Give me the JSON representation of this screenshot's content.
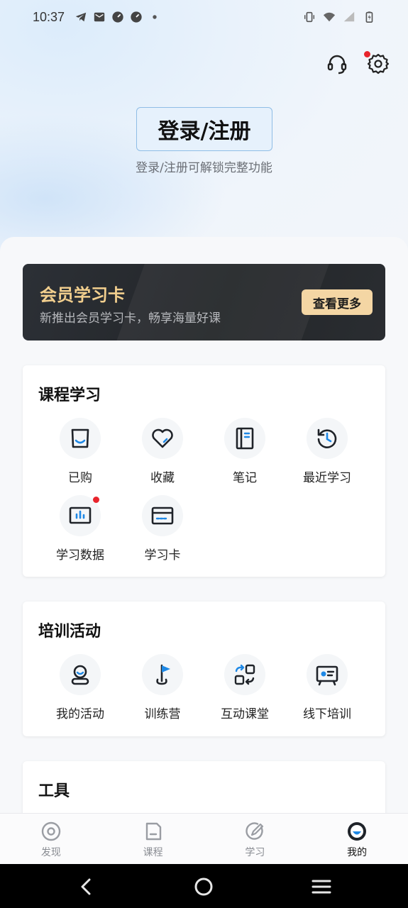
{
  "status_bar": {
    "time": "10:37"
  },
  "header": {
    "login_button": "登录/注册",
    "login_subtitle": "登录/注册可解锁完整功能"
  },
  "vip_card": {
    "title": "会员学习卡",
    "subtitle": "新推出会员学习卡，畅享海量好课",
    "button": "查看更多"
  },
  "course_section": {
    "title": "课程学习",
    "items": [
      {
        "label": "已购",
        "icon": "bag-icon"
      },
      {
        "label": "收藏",
        "icon": "heart-icon"
      },
      {
        "label": "笔记",
        "icon": "notebook-icon"
      },
      {
        "label": "最近学习",
        "icon": "history-icon"
      },
      {
        "label": "学习数据",
        "icon": "chart-board-icon"
      },
      {
        "label": "学习卡",
        "icon": "card-icon"
      }
    ]
  },
  "training_section": {
    "title": "培训活动",
    "items": [
      {
        "label": "我的活动",
        "icon": "user-activity-icon"
      },
      {
        "label": "训练营",
        "icon": "flag-icon"
      },
      {
        "label": "互动课堂",
        "icon": "interactive-class-icon"
      },
      {
        "label": "线下培训",
        "icon": "offline-training-icon"
      }
    ]
  },
  "tools_section": {
    "title": "工具"
  },
  "bottom_nav": {
    "items": [
      {
        "label": "发现",
        "icon": "discover-icon"
      },
      {
        "label": "课程",
        "icon": "course-icon"
      },
      {
        "label": "学习",
        "icon": "study-icon"
      },
      {
        "label": "我的",
        "icon": "profile-icon"
      }
    ],
    "active_index": 3
  },
  "colors": {
    "accent_blue": "#1e88e5",
    "vip_gold": "#f2cf8e",
    "notification_red": "#e8242c"
  }
}
